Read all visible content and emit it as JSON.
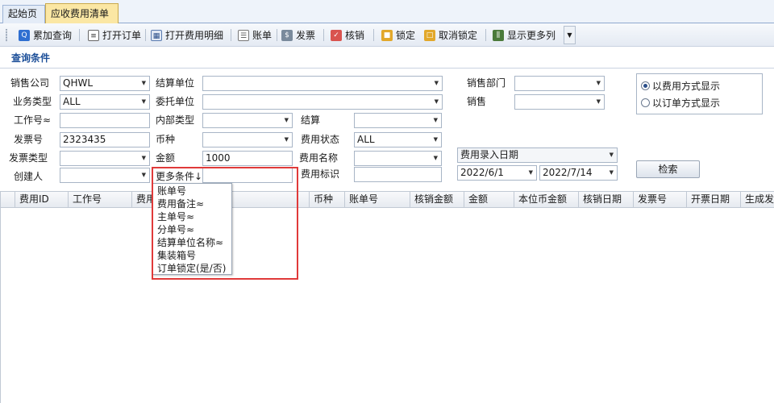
{
  "tabs": [
    {
      "label": "起始页"
    },
    {
      "label": "应收费用清单"
    }
  ],
  "toolbar": {
    "cumulative_query": "累加查询",
    "open_order": "打开订单",
    "open_fee_detail": "打开费用明细",
    "bill": "账单",
    "invoice": "发票",
    "verify": "核销",
    "lock": "锁定",
    "unlock": "取消锁定",
    "show_more_columns": "显示更多列"
  },
  "section": {
    "title": "查询条件"
  },
  "form": {
    "sales_company": {
      "label": "销售公司",
      "value": "QHWL"
    },
    "business_type": {
      "label": "业务类型",
      "value": "ALL"
    },
    "job_no": {
      "label": "工作号≈",
      "value": ""
    },
    "invoice_no": {
      "label": "发票号",
      "value": "2323435"
    },
    "invoice_type": {
      "label": "发票类型",
      "value": ""
    },
    "creator": {
      "label": "创建人",
      "value": ""
    },
    "settle_unit": {
      "label": "结算单位",
      "value": ""
    },
    "entrust_unit": {
      "label": "委托单位",
      "value": ""
    },
    "internal_type": {
      "label": "内部类型",
      "value": ""
    },
    "currency": {
      "label": "币种",
      "value": ""
    },
    "amount": {
      "label": "金额",
      "value": "1000"
    },
    "more_conditions": {
      "label": "更多条件↓",
      "value": ""
    },
    "settle": {
      "label": "结算",
      "value": ""
    },
    "fee_status": {
      "label": "费用状态",
      "value": "ALL"
    },
    "fee_name": {
      "label": "费用名称",
      "value": ""
    },
    "fee_tag": {
      "label": "费用标识",
      "value": ""
    },
    "sales_dept": {
      "label": "销售部门",
      "value": ""
    },
    "sales": {
      "label": "销售",
      "value": ""
    },
    "date_type": {
      "value": "费用录入日期"
    },
    "date_from": {
      "value": "2022/6/1"
    },
    "date_to": {
      "value": "2022/7/14"
    }
  },
  "display_mode": {
    "by_fee": "以费用方式显示",
    "by_order": "以订单方式显示",
    "selected": "by_fee"
  },
  "search_button": "检索",
  "grid": {
    "columns": [
      "费用ID",
      "工作号",
      "费用",
      "",
      "币种",
      "账单号",
      "核销金额",
      "金额",
      "本位币金额",
      "核销日期",
      "发票号",
      "开票日期",
      "生成发"
    ]
  },
  "more_conditions_menu": {
    "items": [
      "账单号",
      "费用备注≈",
      "主单号≈",
      "分单号≈",
      "结算单位名称≈",
      "集装箱号",
      "订单锁定(是/否)"
    ]
  }
}
